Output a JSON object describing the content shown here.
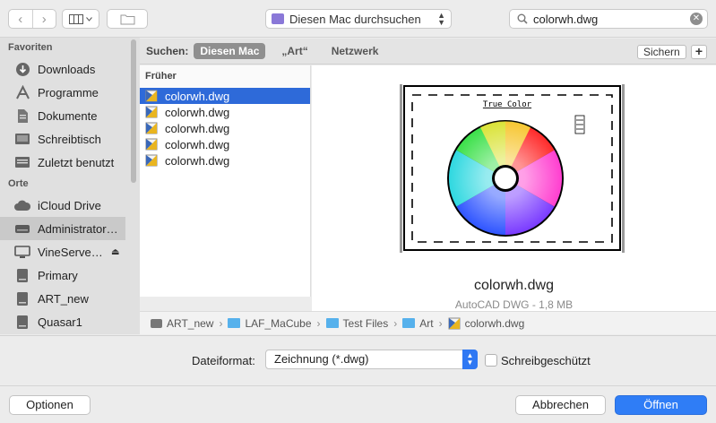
{
  "toolbar": {
    "back_icon": "chevron-left-icon",
    "forward_icon": "chevron-right-icon",
    "view_icon": "column-view-icon",
    "new_folder_icon": "new-folder-icon",
    "location_label": "Diesen Mac durchsuchen",
    "search_value": "colorwh.dwg"
  },
  "sidebar": {
    "favorites_header": "Favoriten",
    "favorites": [
      {
        "label": "Downloads",
        "icon": "download-icon"
      },
      {
        "label": "Programme",
        "icon": "applications-icon"
      },
      {
        "label": "Dokumente",
        "icon": "document-icon"
      },
      {
        "label": "Schreibtisch",
        "icon": "desktop-icon"
      },
      {
        "label": "Zuletzt benutzt",
        "icon": "recents-icon"
      }
    ],
    "places_header": "Orte",
    "places": [
      {
        "label": "iCloud Drive",
        "icon": "cloud-icon"
      },
      {
        "label": "Administrator…",
        "icon": "hard-drive-icon"
      },
      {
        "label": "VineServe…",
        "icon": "display-icon"
      },
      {
        "label": "Primary",
        "icon": "disk-icon"
      },
      {
        "label": "ART_new",
        "icon": "disk-icon"
      },
      {
        "label": "Quasar1",
        "icon": "disk-icon"
      }
    ]
  },
  "scope": {
    "label": "Suchen:",
    "this_mac": "Diesen Mac",
    "art": "„Art“",
    "network": "Netzwerk",
    "save_label": "Sichern",
    "add_label": "+"
  },
  "filelist": {
    "header": "Früher",
    "items": [
      "colorwh.dwg",
      "colorwh.dwg",
      "colorwh.dwg",
      "colorwh.dwg",
      "colorwh.dwg"
    ]
  },
  "preview": {
    "drawing_title": "True Color",
    "filename": "colorwh.dwg",
    "meta": "AutoCAD DWG - 1,8 MB"
  },
  "pathbar": {
    "crumbs": [
      "ART_new",
      "LAF_MaCube",
      "Test Files",
      "Art",
      "colorwh.dwg"
    ]
  },
  "accessory": {
    "format_label": "Dateiformat:",
    "format_value": "Zeichnung (*.dwg)",
    "readonly_label": "Schreibgeschützt"
  },
  "buttons": {
    "options": "Optionen",
    "cancel": "Abbrechen",
    "open": "Öffnen"
  },
  "colors": {
    "accent": "#2f7df6",
    "selection": "#2e6ad9",
    "folder": "#56b1ec"
  }
}
